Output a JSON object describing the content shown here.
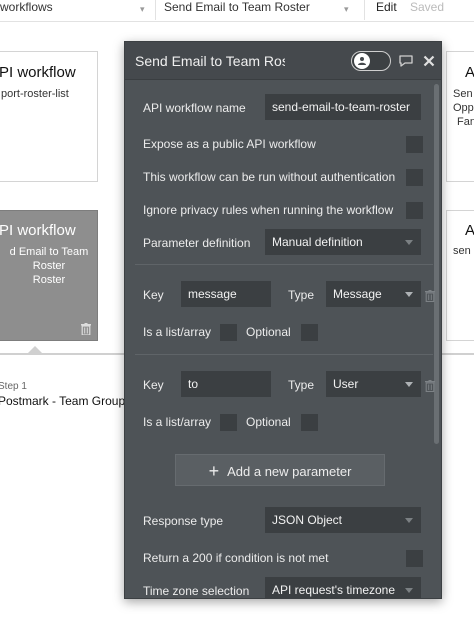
{
  "topbar": {
    "workflow_select": "workflows",
    "event_select": "Send Email to Team Roster",
    "edit_label": "Edit",
    "saved_label": "Saved"
  },
  "canvas": {
    "card_left_top": {
      "title": "PI workflow",
      "subtitle": "port-roster-list"
    },
    "card_left_selected": {
      "title": "PI workflow",
      "subtitle": "d Email to Team Roster"
    },
    "card_right_top": {
      "title": "A",
      "lines": [
        "Sen",
        "Opp",
        "Fan"
      ]
    },
    "card_right_mid": {
      "title": "A",
      "line": "sen"
    },
    "step": {
      "label": "Step 1",
      "title": "Postmark - Team Group"
    }
  },
  "panel": {
    "title": "Send Email to Team Roster",
    "fields": {
      "api_workflow_name": {
        "label": "API workflow name",
        "value": "send-email-to-team-roster"
      },
      "expose_public": {
        "label": "Expose as a public API workflow"
      },
      "no_auth": {
        "label": "This workflow can be run without authentication"
      },
      "ignore_privacy": {
        "label": "Ignore privacy rules when running the workflow"
      },
      "param_definition": {
        "label": "Parameter definition",
        "value": "Manual definition"
      }
    },
    "parameters": [
      {
        "key_label": "Key",
        "key": "message",
        "type_label": "Type",
        "type": "Message",
        "list_label": "Is a list/array",
        "optional_label": "Optional"
      },
      {
        "key_label": "Key",
        "key": "to",
        "type_label": "Type",
        "type": "User",
        "list_label": "Is a list/array",
        "optional_label": "Optional"
      }
    ],
    "add_parameter": "Add a new parameter",
    "response_type": {
      "label": "Response type",
      "value": "JSON Object"
    },
    "return_200": {
      "label": "Return a 200 if condition is not met"
    },
    "timezone": {
      "label": "Time zone selection",
      "value": "API request's timezone"
    }
  },
  "colors": {
    "panel_bg": "#4e5357",
    "field_bg": "#3b3f42",
    "selected_card": "#8e8e8e"
  }
}
